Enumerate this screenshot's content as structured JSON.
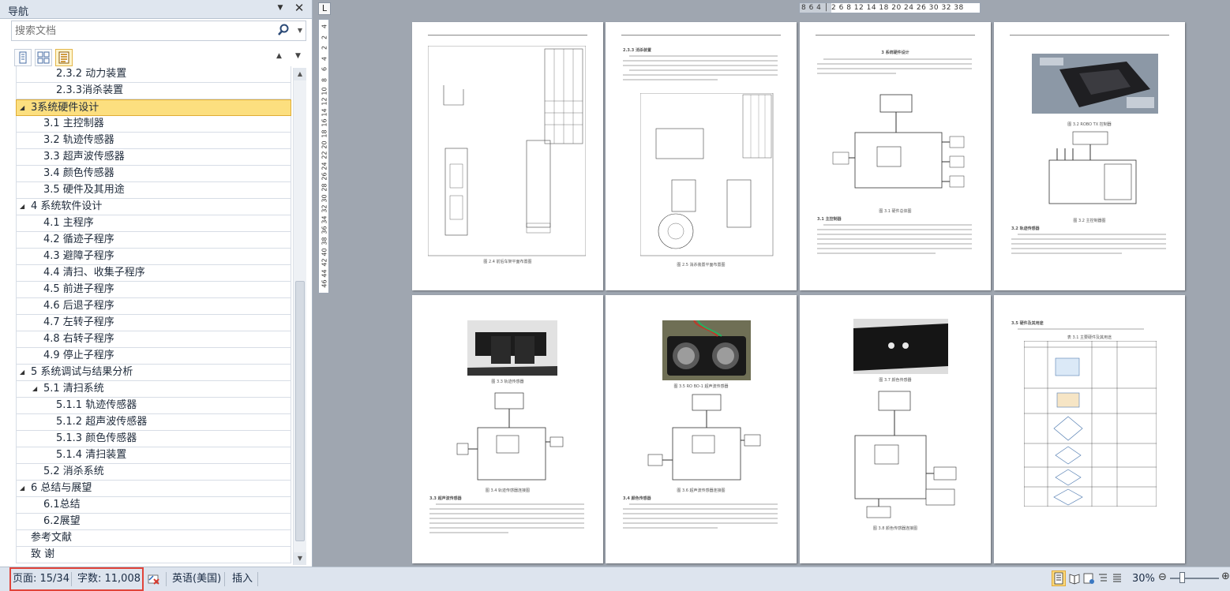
{
  "nav": {
    "title": "导航",
    "search_placeholder": "搜索文档",
    "toc": [
      {
        "label": "2.3.2 动力装置",
        "level": 3,
        "expander": false
      },
      {
        "label": "2.3.3消杀装置",
        "level": 3,
        "expander": false
      },
      {
        "label": "3系统硬件设计",
        "level": 1,
        "expander": true,
        "selected": true
      },
      {
        "label": "3.1 主控制器",
        "level": 2,
        "expander": false
      },
      {
        "label": "3.2 轨迹传感器",
        "level": 2,
        "expander": false
      },
      {
        "label": "3.3 超声波传感器",
        "level": 2,
        "expander": false
      },
      {
        "label": "3.4 颜色传感器",
        "level": 2,
        "expander": false
      },
      {
        "label": "3.5 硬件及其用途",
        "level": 2,
        "expander": false
      },
      {
        "label": "4 系统软件设计",
        "level": 1,
        "expander": true
      },
      {
        "label": "4.1 主程序",
        "level": 2,
        "expander": false
      },
      {
        "label": "4.2 循迹子程序",
        "level": 2,
        "expander": false
      },
      {
        "label": "4.3 避障子程序",
        "level": 2,
        "expander": false
      },
      {
        "label": "4.4 清扫、收集子程序",
        "level": 2,
        "expander": false
      },
      {
        "label": "4.5 前进子程序",
        "level": 2,
        "expander": false
      },
      {
        "label": "4.6 后退子程序",
        "level": 2,
        "expander": false
      },
      {
        "label": "4.7 左转子程序",
        "level": 2,
        "expander": false
      },
      {
        "label": "4.8 右转子程序",
        "level": 2,
        "expander": false
      },
      {
        "label": "4.9 停止子程序",
        "level": 2,
        "expander": false
      },
      {
        "label": "5 系统调试与结果分析",
        "level": 1,
        "expander": true
      },
      {
        "label": "5.1 清扫系统",
        "level": 2,
        "expander": true
      },
      {
        "label": "5.1.1 轨迹传感器",
        "level": 3,
        "expander": false
      },
      {
        "label": "5.1.2 超声波传感器",
        "level": 3,
        "expander": false
      },
      {
        "label": "5.1.3 颜色传感器",
        "level": 3,
        "expander": false
      },
      {
        "label": "5.1.4 清扫装置",
        "level": 3,
        "expander": false
      },
      {
        "label": "5.2 消杀系统",
        "level": 2,
        "expander": false
      },
      {
        "label": "6 总结与展望",
        "level": 1,
        "expander": true
      },
      {
        "label": "6.1总结",
        "level": 2,
        "expander": false
      },
      {
        "label": "6.2展望",
        "level": 2,
        "expander": false
      },
      {
        "label": "参考文献",
        "level": 1,
        "expander": false
      },
      {
        "label": "致 谢",
        "level": 1,
        "expander": false
      }
    ]
  },
  "ruler": {
    "vertical_ticks": [
      "4",
      "2",
      "2",
      "4",
      "6",
      "8",
      "10",
      "12",
      "14",
      "16",
      "18",
      "20",
      "22",
      "24",
      "26",
      "28",
      "30",
      "32",
      "34",
      "36",
      "38",
      "40",
      "42",
      "44",
      "46"
    ],
    "horizontal_text": "8 6 4 │ 2  6 8  12 14  18 20  24 26  30 32  38"
  },
  "pages": [
    {
      "heading": "",
      "caption": "图 2.4 前后车架平面布置图"
    },
    {
      "heading": "2.3.3 消杀装置",
      "caption": "图 2.5 消杀装置平面布置图"
    },
    {
      "heading": "3 系统硬件设计",
      "subheading": "3.1 主控制器",
      "caption": "图 3.1 硬件总体图"
    },
    {
      "heading": "",
      "subheading": "3.2 轨迹传感器",
      "caption": "图 3.2 主控制器图"
    },
    {
      "heading": "",
      "subheading": "3.3 超声波传感器",
      "caption": "图 3.4 轨迹传感器连接图"
    },
    {
      "heading": "",
      "subheading": "3.4 颜色传感器",
      "caption": "图 3.6 超声波传感器连接图"
    },
    {
      "heading": "",
      "subheading": "",
      "caption": "图 3.8 颜色传感器连接图"
    },
    {
      "heading": "3.5 硬件及其用途",
      "subheading": "",
      "caption": "表 3.1 主要硬件及其用途"
    }
  ],
  "status": {
    "page": "页面: 15/34",
    "words": "字数: 11,008",
    "language": "英语(美国)",
    "mode": "插入",
    "zoom": "30%",
    "zoom_level_percent": 30
  },
  "icons": {
    "nav_menu": "dropdown-arrow-icon",
    "close": "close-icon",
    "search": "search-icon",
    "proofing": "proofing-error-icon"
  }
}
